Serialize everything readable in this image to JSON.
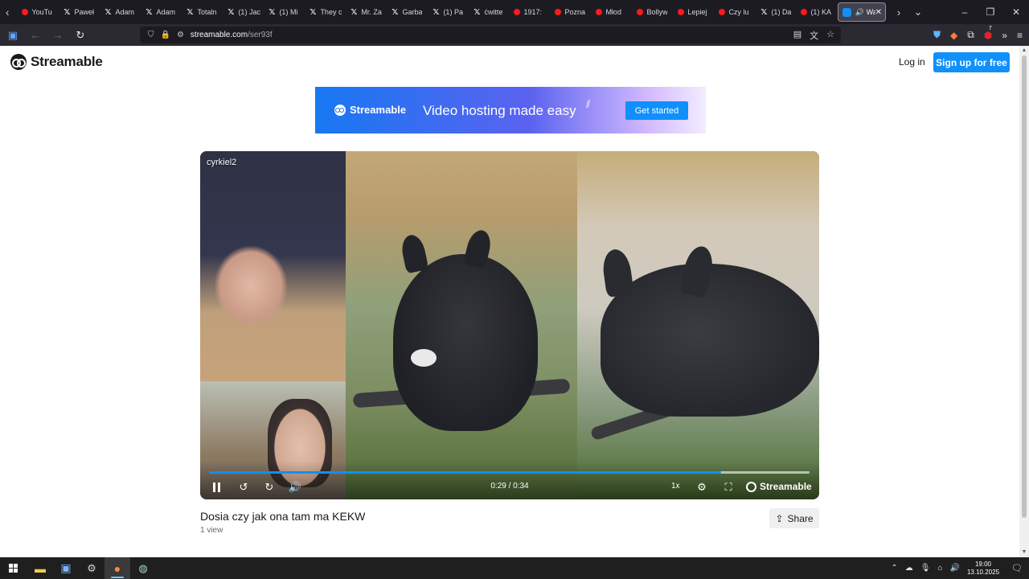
{
  "browser": {
    "tabs": [
      {
        "label": "YouTu",
        "favicon": "youtube-icon"
      },
      {
        "label": "Paweł",
        "favicon": "x-icon"
      },
      {
        "label": "Adam",
        "favicon": "x-icon"
      },
      {
        "label": "Adam",
        "favicon": "x-icon"
      },
      {
        "label": "Totaln",
        "favicon": "x-icon"
      },
      {
        "label": "(1) Jac",
        "favicon": "x-icon"
      },
      {
        "label": "(1) Mi",
        "favicon": "x-icon"
      },
      {
        "label": "They c",
        "favicon": "x-icon"
      },
      {
        "label": "Mr. Za",
        "favicon": "x-icon"
      },
      {
        "label": "Garba",
        "favicon": "x-icon"
      },
      {
        "label": "(1) Pa",
        "favicon": "x-icon"
      },
      {
        "label": "ćwitte",
        "favicon": "x-icon"
      },
      {
        "label": "1917:",
        "favicon": "youtube-icon"
      },
      {
        "label": "Pozna",
        "favicon": "youtube-icon"
      },
      {
        "label": "Młod",
        "favicon": "youtube-icon"
      },
      {
        "label": "Bollyw",
        "favicon": "youtube-icon"
      },
      {
        "label": "Lepiej",
        "favicon": "youtube-icon"
      },
      {
        "label": "Czy lu",
        "favicon": "youtube-icon"
      },
      {
        "label": "(1) Da",
        "favicon": "x-icon"
      },
      {
        "label": "(1) KA",
        "favicon": "youtube-icon"
      }
    ],
    "active_tab": {
      "label": "Wa"
    },
    "url_host": "streamable.com",
    "url_path": "/ser93f",
    "extension_badge": "7"
  },
  "site": {
    "logo_text": "Streamable",
    "login_label": "Log in",
    "signup_label": "Sign up for free"
  },
  "banner": {
    "logo_text": "Streamable",
    "tagline": "Video hosting made easy",
    "cta_label": "Get started"
  },
  "video": {
    "uploader": "cyrkiel2",
    "time_display": "0:29 / 0:34",
    "progress_fraction": 0.853,
    "speed_label": "1x",
    "brand_label": "Streamable",
    "title": "Dosia czy jak ona tam ma KEKW",
    "views": "1 view",
    "share_label": "Share"
  },
  "taskbar": {
    "time": "19:00",
    "date": "13.10.2025"
  },
  "colors": {
    "accent": "#0f90fa",
    "browser_dark": "#1c1b22",
    "taskbar": "#1f1f1f"
  }
}
